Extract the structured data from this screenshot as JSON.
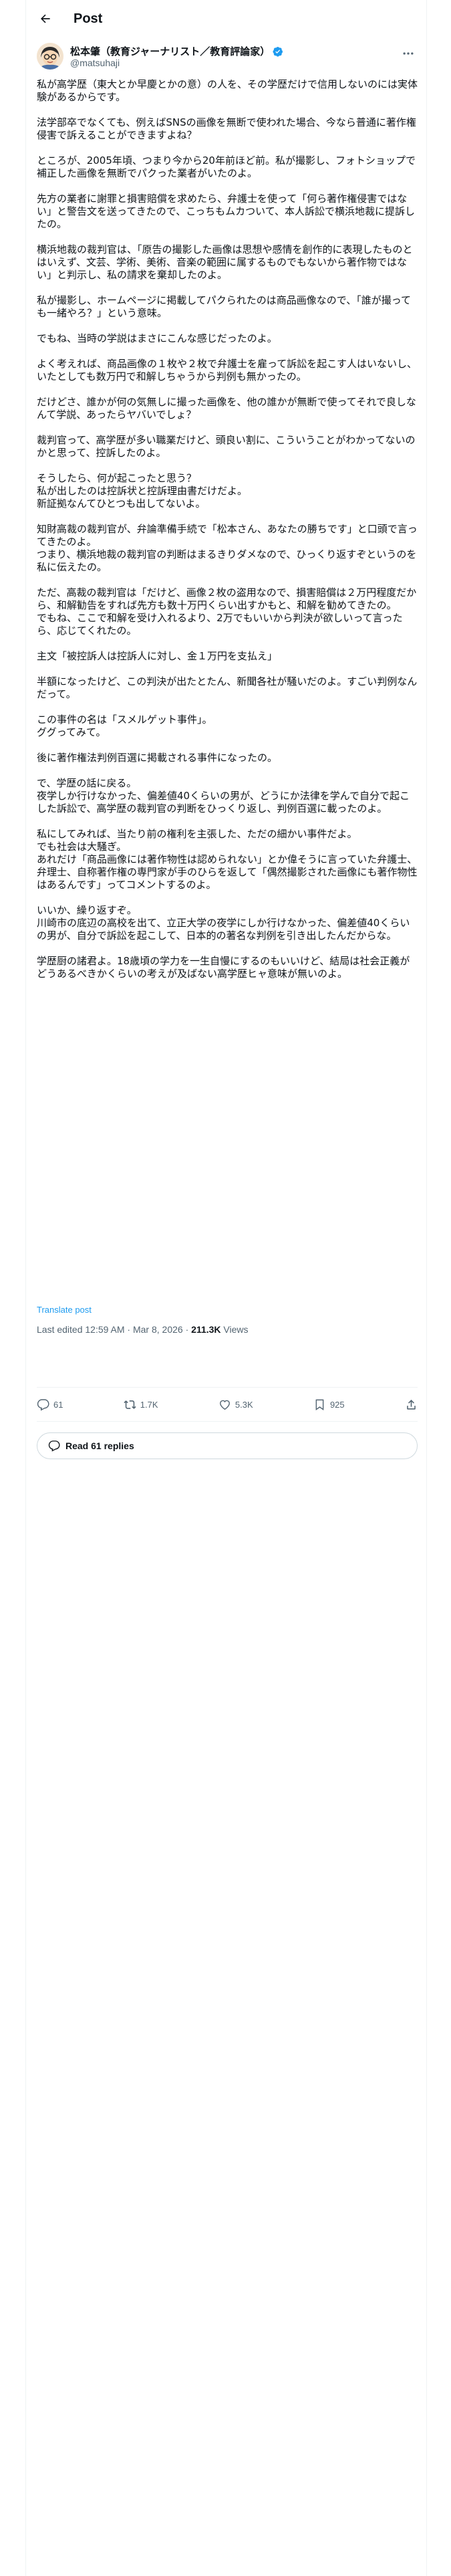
{
  "header": {
    "title": "Post"
  },
  "author": {
    "name": "松本肇（教育ジャーナリスト／教育評論家）",
    "handle": "@matsuhaji"
  },
  "post": {
    "paragraphs": [
      "私が高学歴（東大とか早慶とかの意）の人を、その学歴だけで信用しないのには実体験があるからです。",
      "法学部卒でなくても、例えばSNSの画像を無断で使われた場合、今なら普通に著作権侵害で訴えることができますよね？",
      "ところが、2005年頃、つまり今から20年前ほど前。私が撮影し、フォトショップで補正した画像を無断でパクった業者がいたのよ。",
      "先方の業者に謝罪と損害賠償を求めたら、弁護士を使って「何ら著作権侵害ではない」と警告文を送ってきたので、こっちもムカついて、本人訴訟で横浜地裁に提訴したの。",
      "横浜地裁の裁判官は、「原告の撮影した画像は思想や感情を創作的に表現したものとはいえず、文芸、学術、美術、音楽の範囲に属するものでもないから著作物ではない」と判示し、私の請求を棄却したのよ。",
      "私が撮影し、ホームページに掲載してパクられたのは商品画像なので、「誰が撮っても一緒やろ？」という意味。",
      "でもね、当時の学説はまさにこんな感じだったのよ。",
      "よく考えれば、商品画像の１枚や２枚で弁護士を雇って訴訟を起こす人はいないし、いたとしても数万円で和解しちゃうから判例も無かったの。",
      "だけどさ、誰かが何の気無しに撮った画像を、他の誰かが無断で使ってそれで良しなんて学説、あったらヤバいでしょ？",
      "裁判官って、高学歴が多い職業だけど、頭良い割に、こういうことがわかってないのかと思って、控訴したのよ。",
      "そうしたら、何が起こったと思う？\n私が出したのは控訴状と控訴理由書だけだよ。\n新証拠なんてひとつも出してないよ。",
      "知財高裁の裁判官が、弁論準備手続で「松本さん、あなたの勝ちです」と口頭で言ってきたのよ。\nつまり、横浜地裁の裁判官の判断はまるきりダメなので、ひっくり返すぞというのを私に伝えたの。",
      "ただ、高裁の裁判官は「だけど、画像２枚の盗用なので、損害賠償は２万円程度だから、和解勧告をすれば先方も数十万円くらい出すかもと、和解を勧めてきたの。\nでもね、ここで和解を受け入れるより、2万でもいいから判決が欲しいって言ったら、応じてくれたの。",
      "主文「被控訴人は控訴人に対し、金１万円を支払え」",
      "半額になったけど、この判決が出たとたん、新聞各社が騒いだのよ。すごい判例なんだって。",
      "この事件の名は「スメルゲット事件」。\nググってみて。",
      "後に著作権法判例百選に掲載される事件になったの。",
      "で、学歴の話に戻る。\n夜学しか行けなかった、偏差値40くらいの男が、どうにか法律を学んで自分で起こした訴訟で、高学歴の裁判官の判断をひっくり返し、判例百選に載ったのよ。",
      "私にしてみれば、当たり前の権利を主張した、ただの細かい事件だよ。\nでも社会は大騒ぎ。\nあれだけ「商品画像には著作物性は認められない」とか偉そうに言っていた弁護士、弁理士、自称著作権の専門家が手のひらを返して「偶然撮影された画像にも著作物性はあるんです」ってコメントするのよ。",
      "いいか、繰り返すぞ。\n川崎市の底辺の高校を出て、立正大学の夜学にしか行けなかった、偏差値40くらいの男が、自分で訴訟を起こして、日本的の著名な判例を引き出したんだからな。",
      "学歴厨の諸君よ。18歳頃の学力を一生自慢にするのもいいけど、結局は社会正義がどうあるべきかくらいの考えが及ばない高学歴ヒャ意味が無いのよ。"
    ],
    "translate_label": "Translate post",
    "timestamp": "Last edited 12:59 AM · Mar 8, 2026",
    "views_count": "211.3K",
    "views_label": "Views"
  },
  "stats": {
    "replies": "61",
    "reposts": "1.7K",
    "likes": "5.3K",
    "bookmarks": "925"
  },
  "read_replies_label": "Read 61 replies",
  "colors": {
    "accent": "#1d9bf0",
    "muted": "#536471",
    "border": "#eff3f4"
  }
}
